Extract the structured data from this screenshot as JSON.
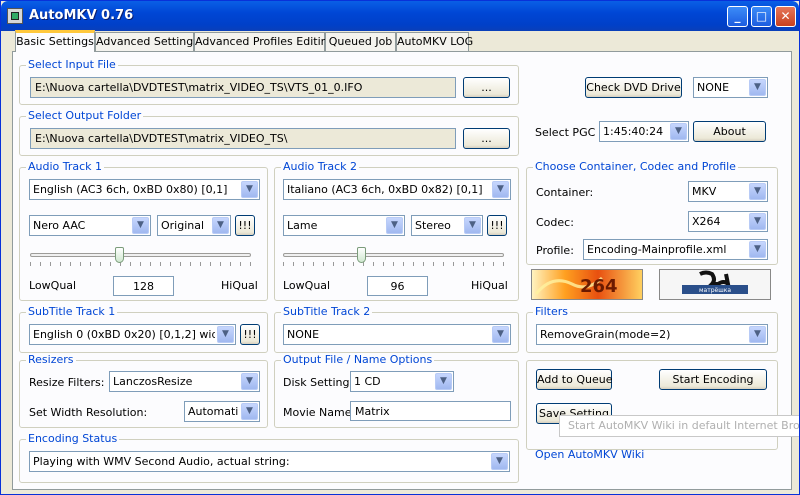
{
  "window": {
    "title": "AutoMKV 0.76",
    "minimize_glyph": "_",
    "maximize_glyph": "□",
    "close_glyph": "✕"
  },
  "tabs": [
    {
      "label": "Basic Settings",
      "active": true
    },
    {
      "label": "Advanced Settings"
    },
    {
      "label": "Advanced Profiles Editing"
    },
    {
      "label": "Queued Job"
    },
    {
      "label": "AutoMKV LOG"
    }
  ],
  "input_file": {
    "title": "Select Input File",
    "path": "E:\\Nuova cartella\\DVDTEST\\matrix_VIDEO_TS\\VTS_01_0.IFO",
    "browse_label": "..."
  },
  "output_folder": {
    "title": "Select Output Folder",
    "path": "E:\\Nuova cartella\\DVDTEST\\matrix_VIDEO_TS\\",
    "browse_label": "..."
  },
  "dvd": {
    "check_label": "Check DVD Drive",
    "drive_value": "NONE",
    "pgc_label": "Select PGC",
    "pgc_value": "1:45:40:24",
    "about_label": "About"
  },
  "audio1": {
    "title": "Audio Track 1",
    "track": "English (AC3 6ch, 0xBD 0x80) [0,1]",
    "codec": "Nero AAC",
    "channels": "Original",
    "warn_label": "!!!",
    "low_label": "LowQual",
    "high_label": "HiQual",
    "bitrate": "128",
    "quality_level": 0.4
  },
  "audio2": {
    "title": "Audio Track 2",
    "track": "Italiano (AC3 6ch, 0xBD 0x82) [0,1]",
    "codec": "Lame",
    "channels": "Stereo",
    "warn_label": "!!!",
    "low_label": "LowQual",
    "high_label": "HiQual",
    "bitrate": "96",
    "quality_level": 0.35
  },
  "container": {
    "title": "Choose Container, Codec and Profile",
    "container_label": "Container:",
    "container_value": "MKV",
    "codec_label": "Codec:",
    "codec_value": "X264",
    "profile_label": "Profile:",
    "profile_value": "Encoding-Mainprofile.xml"
  },
  "logos": {
    "x264_text": "264",
    "matroska_text": "матрёшка"
  },
  "subtitle1": {
    "title": "SubTitle Track 1",
    "value": "English 0 (0xBD 0x20) [0,1,2] wide",
    "warn_label": "!!!"
  },
  "subtitle2": {
    "title": "SubTitle Track 2",
    "value": "NONE"
  },
  "filters": {
    "title": "Filters",
    "value": "RemoveGrain(mode=2)"
  },
  "resizers": {
    "title": "Resizers",
    "filter_label": "Resize Filters:",
    "filter_value": "LanczosResize",
    "width_label": "Set Width Resolution:",
    "width_value": "Automatic"
  },
  "output_options": {
    "title": "Output File / Name Options",
    "disk_label": "Disk Settings:",
    "disk_value": "1 CD",
    "movie_label": "Movie Name:",
    "movie_value": "Matrix"
  },
  "actions": {
    "add_queue": "Add to Queue",
    "start_encoding": "Start Encoding",
    "save_setting": "Save Setting",
    "tooltip": "Start AutoMKV Wiki in default Internet Browser",
    "wiki_link": "Open AutoMKV Wiki"
  },
  "status": {
    "title": "Encoding Status",
    "value": "Playing with WMV Second Audio, actual string:"
  },
  "colors": {
    "titlebar": "#0046d5",
    "group_title": "#0046d5",
    "panel": "#fcfcfe",
    "window": "#ece9d8"
  }
}
